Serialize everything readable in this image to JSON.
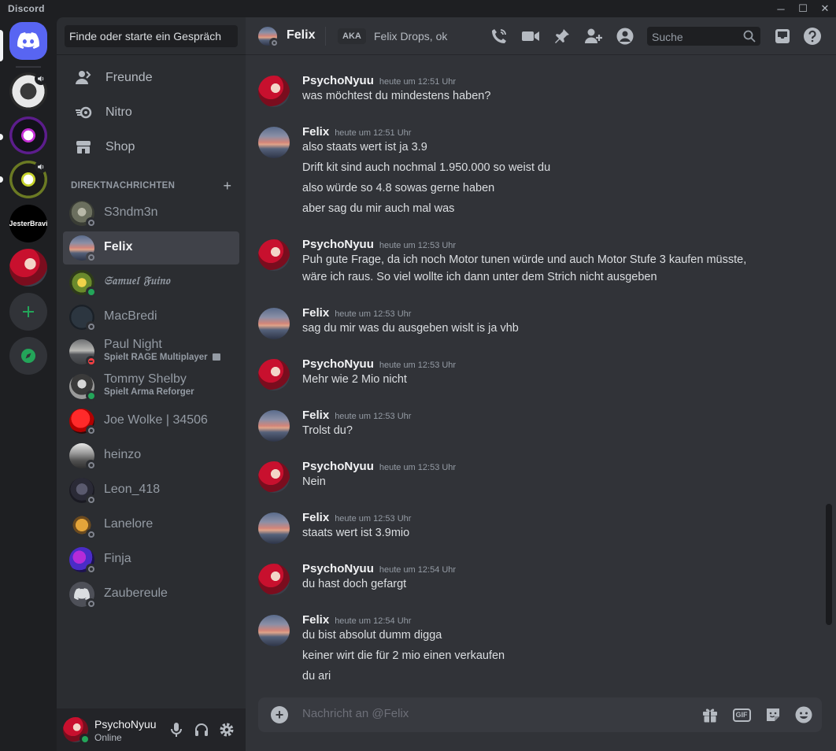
{
  "window": {
    "title": "Discord",
    "controls": [
      "─",
      "☐",
      "✕"
    ]
  },
  "sidebar": {
    "search_placeholder": "Finde oder starte ein Gespräch",
    "nav": [
      {
        "label": "Freunde",
        "icon": "friends-icon"
      },
      {
        "label": "Nitro",
        "icon": "nitro-icon"
      },
      {
        "label": "Shop",
        "icon": "shop-icon"
      }
    ],
    "dm_header": "DIREKTNACHRICHTEN",
    "dms": [
      {
        "name": "S3ndm3n",
        "status": "offline"
      },
      {
        "name": "Felix",
        "status": "offline",
        "active": true
      },
      {
        "name": "𝔖𝔞𝔪𝔲𝔢𝔩 𝔉𝔲𝔦𝔫𝔬",
        "status": "online"
      },
      {
        "name": "MacBredi",
        "status": "offline"
      },
      {
        "name": "Paul Night",
        "activity": "Spielt RAGE Multiplayer",
        "status": "dnd"
      },
      {
        "name": "Tommy Shelby",
        "activity": "Spielt Arma Reforger",
        "status": "online"
      },
      {
        "name": "Joe Wolke | 34506",
        "status": "offline"
      },
      {
        "name": "heinzo",
        "status": "offline"
      },
      {
        "name": "Leon_418",
        "status": "offline"
      },
      {
        "name": "Lanelore",
        "status": "offline"
      },
      {
        "name": "Finja",
        "status": "offline"
      },
      {
        "name": "Zaubereule",
        "status": "offline"
      }
    ],
    "user": {
      "name": "PsychoNyuu",
      "status": "Online"
    }
  },
  "chat": {
    "header": {
      "name": "Felix",
      "aka_label": "AKA",
      "aka_names": "Felix Drops, ok",
      "search_placeholder": "Suche"
    },
    "messages": [
      {
        "author": "PsychoNyuu",
        "time": "heute um 12:51 Uhr",
        "lines": [
          "was möchtest du mindestens haben?"
        ]
      },
      {
        "author": "Felix",
        "time": "heute um 12:51 Uhr",
        "lines": [
          "also staats wert ist ja 3.9",
          "Drift kit sind auch nochmal 1.950.000 so weist du",
          "also würde so 4.8 sowas gerne haben",
          "aber sag du mir auch mal was"
        ]
      },
      {
        "author": "PsychoNyuu",
        "time": "heute um 12:53 Uhr",
        "lines": [
          "Puh gute Frage, da ich noch Motor tunen würde und auch Motor Stufe 3 kaufen müsste,",
          "wäre ich raus. So viel wollte ich dann unter dem Strich nicht ausgeben"
        ]
      },
      {
        "author": "Felix",
        "time": "heute um 12:53 Uhr",
        "lines": [
          "sag du mir was du ausgeben wislt is ja vhb"
        ]
      },
      {
        "author": "PsychoNyuu",
        "time": "heute um 12:53 Uhr",
        "lines": [
          "Mehr wie 2 Mio nicht"
        ]
      },
      {
        "author": "Felix",
        "time": "heute um 12:53 Uhr",
        "lines": [
          "Trolst du?"
        ]
      },
      {
        "author": "PsychoNyuu",
        "time": "heute um 12:53 Uhr",
        "lines": [
          "Nein"
        ]
      },
      {
        "author": "Felix",
        "time": "heute um 12:53 Uhr",
        "lines": [
          "staats wert ist 3.9mio"
        ]
      },
      {
        "author": "PsychoNyuu",
        "time": "heute um 12:54 Uhr",
        "lines": [
          "du hast doch gefargt"
        ]
      },
      {
        "author": "Felix",
        "time": "heute um 12:54 Uhr",
        "lines": [
          "du bist absolut dumm digga",
          "keiner wirt die für 2 mio einen verkaufen",
          "du ari"
        ]
      }
    ],
    "composer_placeholder": "Nachricht an @Felix",
    "composer_gif": "GIF"
  },
  "servers": [
    {
      "icon": "discord-home-icon"
    },
    {
      "icon": "server-icon-1",
      "voice": true
    },
    {
      "icon": "server-icon-2"
    },
    {
      "icon": "server-icon-3",
      "voice": true
    },
    {
      "icon": "server-icon-jesterbravi",
      "label": "JesterBravi"
    },
    {
      "icon": "server-icon-psycho"
    },
    {
      "icon": "add-server-icon"
    },
    {
      "icon": "explore-icon"
    }
  ],
  "colors": {
    "accent": "#5865f2",
    "online": "#23a559",
    "dnd": "#f23f43",
    "offline": "#80848e",
    "background": "#313338",
    "sidebar": "#2b2d31"
  }
}
